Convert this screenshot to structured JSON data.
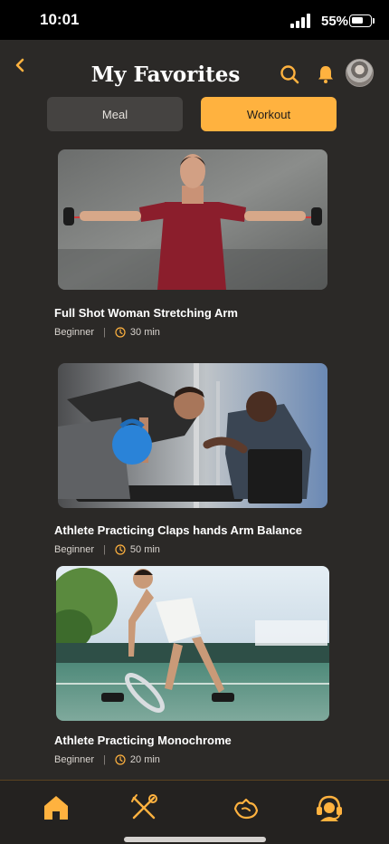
{
  "status_bar": {
    "time": "10:01",
    "battery_percent": "55%"
  },
  "header": {
    "title": "My Favorites",
    "back_icon": "chevron-left-icon",
    "search_icon": "search-icon",
    "notification_icon": "bell-icon",
    "avatar": "avatar"
  },
  "tabs": [
    {
      "label": "Meal",
      "active": false
    },
    {
      "label": "Workout",
      "active": true
    }
  ],
  "workouts": [
    {
      "title": "Full Shot Woman Stretching Arm",
      "level": "Beginner",
      "duration": "30 min",
      "image": "man in red shirt stretching resistance band"
    },
    {
      "title": "Athlete Practicing Claps hands Arm Balance",
      "level": "Beginner",
      "duration": "50 min",
      "image": "athlete lifting kettlebell with trainer"
    },
    {
      "title": "Athlete Practicing Monochrome",
      "level": "Beginner",
      "duration": "20 min",
      "image": "tennis player stretching on court"
    }
  ],
  "bottom_nav": [
    {
      "icon": "home-icon",
      "active": true
    },
    {
      "icon": "meal-icon",
      "active": false
    },
    {
      "icon": "workout-icon",
      "active": false
    },
    {
      "icon": "support-icon",
      "active": false
    }
  ],
  "colors": {
    "accent": "#ffb23f",
    "background": "#2b2927",
    "tab_inactive": "#454341"
  }
}
